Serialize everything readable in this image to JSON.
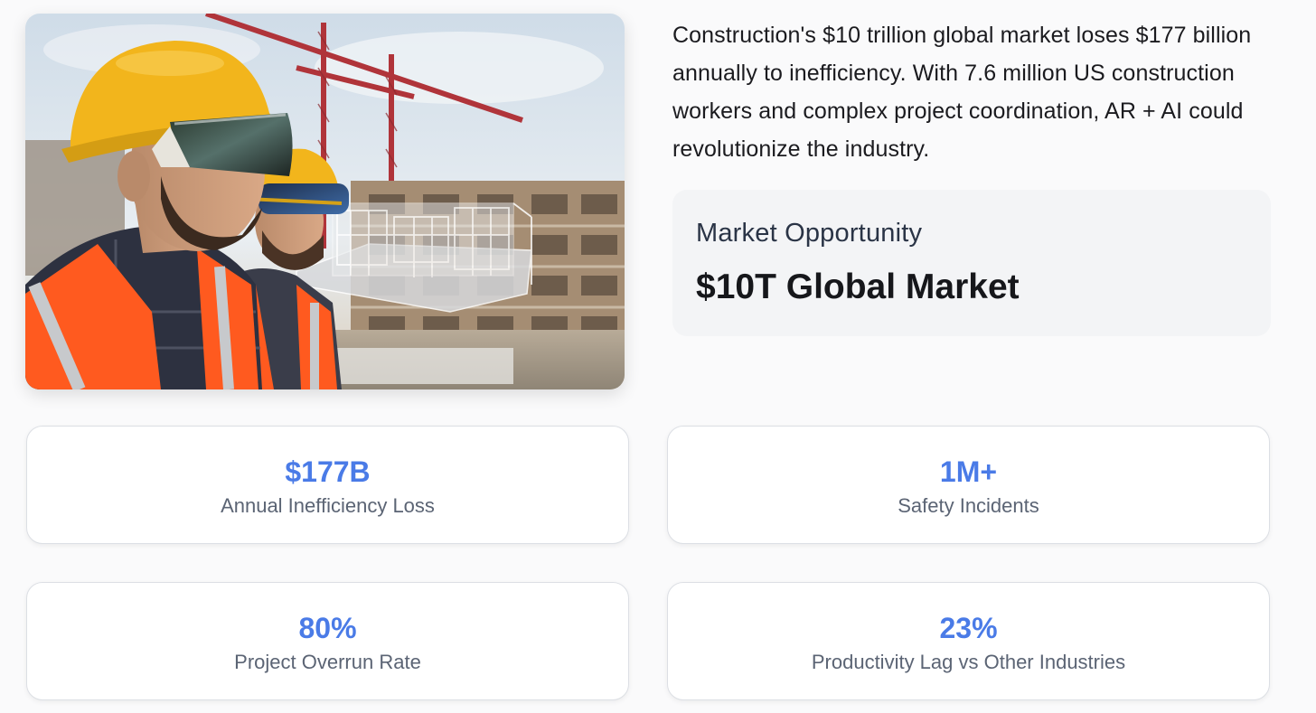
{
  "intro": {
    "text": "Construction's $10 trillion global market loses $177 billion annually to inefficiency. With 7.6 million US construction workers and complex project coordination, AR + AI could revolutionize the industry."
  },
  "market": {
    "label": "Market Opportunity",
    "value": "$10T Global Market"
  },
  "stats": [
    {
      "value": "$177B",
      "label": "Annual Inefficiency Loss"
    },
    {
      "value": "1M+",
      "label": "Safety Incidents"
    },
    {
      "value": "80%",
      "label": "Project Overrun Rate"
    },
    {
      "value": "23%",
      "label": "Productivity Lag vs Other Industries"
    }
  ],
  "colors": {
    "accent": "#4a7be7",
    "card_bg": "#f3f4f6",
    "vest": "#ff5a1f",
    "helmet": "#f2b51c"
  }
}
